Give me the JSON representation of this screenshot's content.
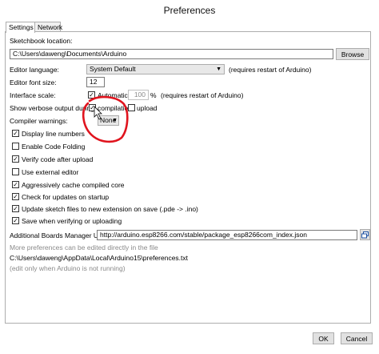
{
  "window": {
    "title": "Preferences"
  },
  "tabs": [
    {
      "label": "Settings"
    },
    {
      "label": "Network"
    }
  ],
  "sketchbook": {
    "label": "Sketchbook location:",
    "value": "C:\\Users\\daweng\\Documents\\Arduino",
    "browse_label": "Browse"
  },
  "language": {
    "label": "Editor language:",
    "value": "System Default",
    "note": "(requires restart of Arduino)"
  },
  "font_size": {
    "label": "Editor font size:",
    "value": "12"
  },
  "interface_scale": {
    "label": "Interface scale:",
    "automatic_label": "Automatic",
    "value": "100",
    "unit": "%",
    "note": "(requires restart of Arduino)"
  },
  "verbose": {
    "label": "Show verbose output during:",
    "compilation_label": "compilation",
    "upload_label": "upload"
  },
  "compiler_warnings": {
    "label": "Compiler warnings:",
    "value": "None"
  },
  "checkboxes": [
    {
      "label": "Display line numbers",
      "checked": true
    },
    {
      "label": "Enable Code Folding",
      "checked": false
    },
    {
      "label": "Verify code after upload",
      "checked": true
    },
    {
      "label": "Use external editor",
      "checked": false
    },
    {
      "label": "Aggressively cache compiled core",
      "checked": true
    },
    {
      "label": "Check for updates on startup",
      "checked": true
    },
    {
      "label": "Update sketch files to new extension on save (.pde -> .ino)",
      "checked": true
    },
    {
      "label": "Save when verifying or uploading",
      "checked": true
    }
  ],
  "boards_manager": {
    "label": "Additional Boards Manager URLs:",
    "value": "http://arduino.esp8266.com/stable/package_esp8266com_index.json"
  },
  "more_prefs": {
    "text": "More preferences can be edited directly in the file"
  },
  "prefs_path": {
    "text": "C:\\Users\\daweng\\AppData\\Local\\Arduino15\\preferences.txt"
  },
  "edit_note": {
    "text": "(edit only when Arduino is not running)"
  },
  "buttons": {
    "ok_label": "OK",
    "cancel_label": "Cancel"
  },
  "check_mark": "✓",
  "colors": {
    "annotation_red": "#e0141e"
  }
}
